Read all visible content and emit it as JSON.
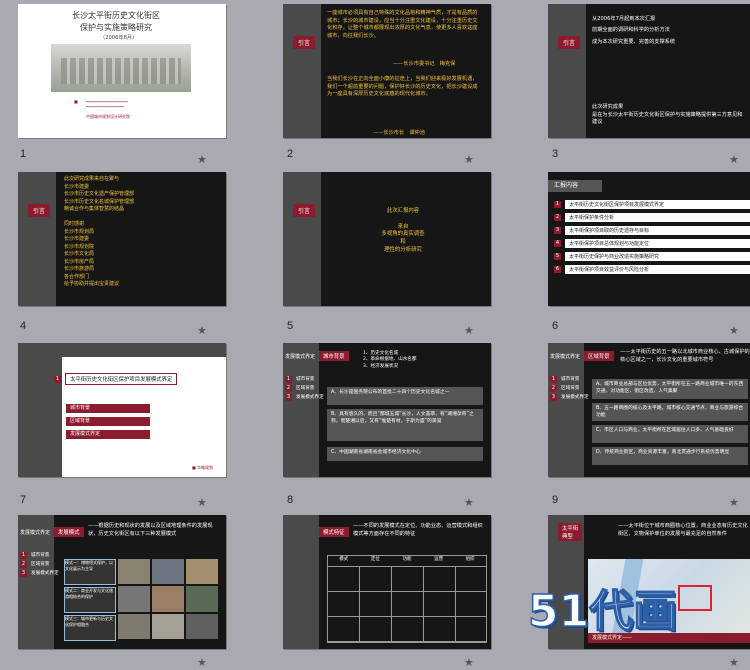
{
  "slides": {
    "s1": {
      "num": "1",
      "title": "长沙太平街历史文化街区\n保护与实施策略研究",
      "date": "（2006年8月）",
      "logo": "中国城市规划设计研究院"
    },
    "s2": {
      "num": "2",
      "tag": "引言",
      "text1": "一座城市必须具有自己特殊的文化品格和精神气质，才是有品质的城市；长沙的城市建设，应当十分注重文化建设，十分注重历史文化积存，让整个城市都展现出浓厚的文化气息，使更多人喜欢这座城市，向往我们长沙。",
      "sign1": "——长沙市委书记　梅克保",
      "text2": "当我们长沙在正向全面小康的征途上，当我们迎来极好发展机遇，我们一个超前重要的问题，保护好长沙的历史文化，把长沙建设成为一座具有深厚历史文化底蕴的现代化城市。",
      "sign2": "——长沙市长　谭仲池"
    },
    "s3": {
      "num": "3",
      "tag": "引言",
      "text1": "从2006年7月起到本次汇报\n前期全面的调研和科学的分析方法\n成为本次研究重要、完善的支撑系统",
      "text2": "此次研究成果\n是在为长沙太平街历史文化街区保护与实施策略提供第三方意见和建议"
    },
    "s4": {
      "num": "4",
      "tag": "引言",
      "text": "此次研究成果来自在聚与\n长沙市建委\n长沙市历史文化遗产保护管理部\n长沙市历史文化名城保护管理部\n精诚合作与集体智慧的结晶\n\n同时感谢\n长沙市规划局\n长沙市建委\n长沙市规划院\n长沙市文化局\n长沙市房产局\n长沙市旅游局\n各合作部门\n给予协助并提出宝贵建议"
    },
    "s5": {
      "num": "5",
      "tag": "引言",
      "text": "此次汇报内容\n\n来自\n多视角的真实调查\n和\n理性的分析研究"
    },
    "s6": {
      "num": "6",
      "header": "汇报内容",
      "items": [
        "太平街历史文化街区保护项目发展模式界定",
        "太平街保护条件分析",
        "太平街保护项目取的历史遗存与目标",
        "太平街保护项目总体规划与功能定位",
        "太平街历史保护与商业改造实施策略研究",
        "太平街保护项目效益评价与风险分析"
      ]
    },
    "s7": {
      "num": "7",
      "heading": "太平街历史文化街区保护项目发展模式界定",
      "subs": [
        "城市背景",
        "区域背景",
        "发展模式界定"
      ]
    },
    "s8": {
      "num": "8",
      "tab1": "发展模式界定",
      "tab2": "城市背景",
      "side": [
        "城市背景",
        "区域背景",
        "发展模式界定"
      ],
      "bullets": [
        "历史文化名城",
        "革命根据地、山水名都",
        "经济发展状况"
      ],
      "blocks": [
        "A、长沙是国务院公布的首批二十四个历史文化名城之一",
        "B、具有悠久的、而且“都城五城”长沙，人文荟萃、有“湖湘孕育”之称，而楚湘以后，又有“惟楚有材，于斯为盛”的美誉",
        "C、中国湖南省湖南省会城市经济文化中心"
      ]
    },
    "s9": {
      "num": "9",
      "tab1": "发展模式界定",
      "tab2": "区域背景",
      "side": [
        "城市背景",
        "区域背景",
        "发展模式界定"
      ],
      "intro": "——太平街历史的五一路以北城市商业核心、古城保护的核心区域之一，长沙文化的重要城市符号",
      "blocks": [
        "A、城市商业总部与区位优势，太平街所在五一路商业城市唯一的东西交通，对功能区、街区改造、人气集聚",
        "B、五一路商圈的核心及太平路，城市核心交通节点、商业与旅游综合功能",
        "C、市区人口与商业，太平街所在区域居住人口多、人气基础良好",
        "D、传统商业街区，商业资源丰富，南北贯通步行系统优势明显"
      ]
    },
    "s10": {
      "num": "",
      "tab1": "发展模式界定",
      "tab2": "发展模式",
      "side": [
        "城市背景",
        "区域背景",
        "发展模式界定"
      ],
      "intro": "——根据历史和现状的发展以及区域地理条件的发展现状，历史文化街区有以下三种发展模式",
      "captions": [
        "模式一：博物馆式保护，以文化展示为主导",
        "模式二：商业开发与文化旅游相结合的保护",
        "模式三：城市更新与历史文化保护相融合"
      ]
    },
    "s11": {
      "num": "",
      "tab1": "模式特征",
      "intro": "——不同的发展模式在定位、功能业态、运营模式和组织模式等方面存在不同的特征",
      "cols": [
        "模式",
        "定位",
        "功能",
        "运营",
        "组织"
      ]
    },
    "s12": {
      "num": "",
      "tab1": "太平街\n典型",
      "intro": "——太平街位于城市商圈核心位置，商业业态有历史文化街区、文物保护单位的发展与最充足的自然条件",
      "banner": "发展模式界定——",
      "watermark": "51代画"
    }
  },
  "colors": {
    "accent": "#8b1c2e",
    "yellow": "#f2c23a",
    "dark": "#161616",
    "bg": "#a9a9b2"
  }
}
